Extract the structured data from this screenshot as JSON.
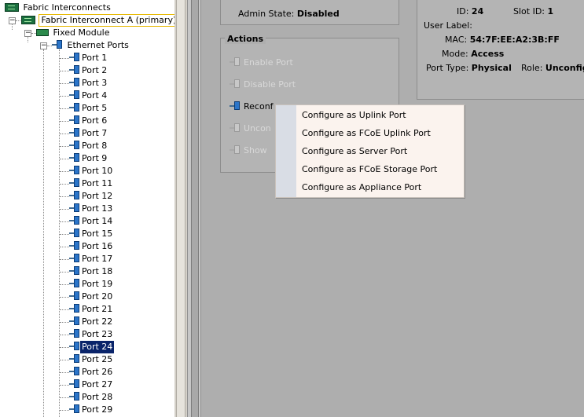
{
  "tree": {
    "root": "Fabric Interconnects",
    "fi": "Fabric Interconnect A (primary)",
    "module": "Fixed Module",
    "ports_group": "Ethernet Ports",
    "ports": [
      "Port 1",
      "Port 2",
      "Port 3",
      "Port 4",
      "Port 5",
      "Port 6",
      "Port 7",
      "Port 8",
      "Port 9",
      "Port 10",
      "Port 11",
      "Port 12",
      "Port 13",
      "Port 14",
      "Port 15",
      "Port 16",
      "Port 17",
      "Port 18",
      "Port 19",
      "Port 20",
      "Port 21",
      "Port 22",
      "Port 23",
      "Port 24",
      "Port 25",
      "Port 26",
      "Port 27",
      "Port 28",
      "Port 29"
    ],
    "selected": "Port 24"
  },
  "status": {
    "admin_state_label": "Admin State:",
    "admin_state_value": "Disabled"
  },
  "properties": {
    "id_label": "ID:",
    "id_value": "24",
    "slot_label": "Slot ID:",
    "slot_value": "1",
    "user_label": "User Label:",
    "mac_label": "MAC:",
    "mac_value": "54:7F:EE:A2:3B:FF",
    "mode_label": "Mode:",
    "mode_value": "Access",
    "port_type_label": "Port Type:",
    "port_type_value": "Physical",
    "role_label": "Role:",
    "role_value": "Unconfig"
  },
  "actions": {
    "title": "Actions",
    "enable_port": "Enable Port",
    "disable_port": "Disable Port",
    "reconfigure": "Reconf",
    "unconfigure": "Uncon",
    "show": "Show"
  },
  "context_menu": {
    "items": [
      "Configure as Uplink Port",
      "Configure as FCoE Uplink Port",
      "Configure as Server Port",
      "Configure as FCoE Storage Port",
      "Configure as Appliance Port"
    ]
  },
  "colors": {
    "selection": "#0a246a",
    "panel_bg": "#aeaeae",
    "menu_bg": "#fbf3ee",
    "port_icon": "#2b75c9"
  }
}
